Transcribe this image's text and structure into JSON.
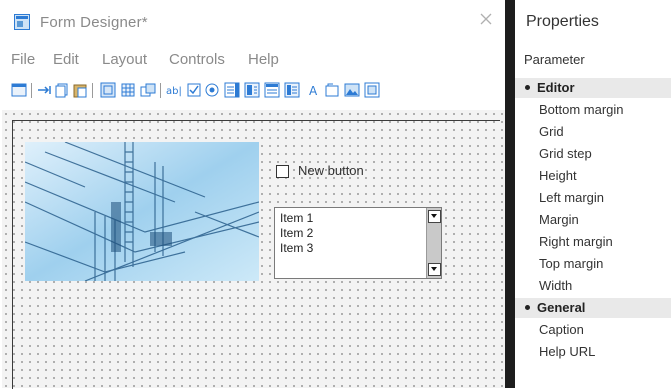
{
  "window": {
    "title": "Form Designer*"
  },
  "menu": [
    "File",
    "Edit",
    "Layout",
    "Controls",
    "Help"
  ],
  "toolbar": {
    "icons": [
      "form-icon",
      "tab-order-icon",
      "copy-icon",
      "paste-icon",
      "align-icon",
      "grid-icon",
      "size-icon",
      "textbox-icon",
      "checkbox-icon",
      "radio-icon",
      "listbox-icon",
      "combobox-icon",
      "listview-icon",
      "treeview-icon",
      "label-icon",
      "frame-icon",
      "image-icon",
      "more-icon"
    ]
  },
  "form": {
    "checkbox_label": "New button",
    "listbox_items": [
      "Item 1",
      "Item 2",
      "Item 3"
    ]
  },
  "properties": {
    "title": "Properties",
    "column_header": "Parameter",
    "categories": [
      {
        "name": "Editor",
        "items": [
          "Bottom margin",
          "Grid",
          "Grid step",
          "Height",
          "Left margin",
          "Margin",
          "Right margin",
          "Top margin",
          "Width"
        ]
      },
      {
        "name": "General",
        "items": [
          "Caption",
          "Help URL"
        ]
      }
    ]
  },
  "colors": {
    "accent": "#2d7bd4",
    "canvas_bg": "#f3f3f3",
    "divider": "#1d1d1d"
  }
}
